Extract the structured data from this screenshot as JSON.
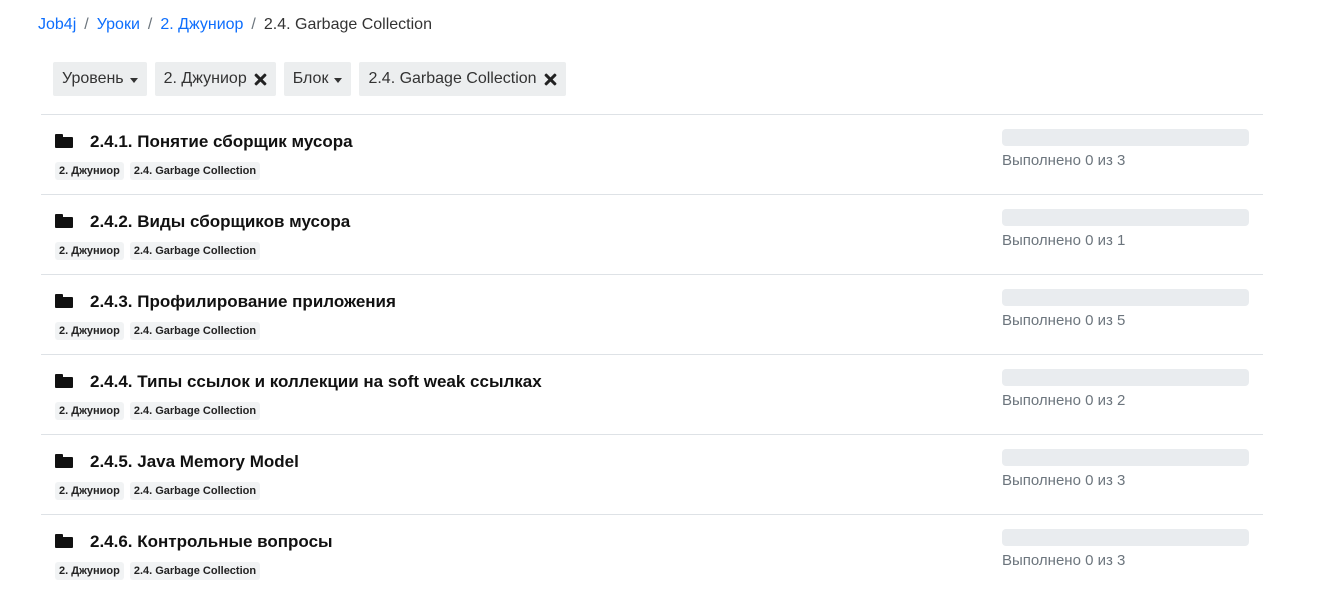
{
  "breadcrumb": {
    "items": [
      "Job4j",
      "Уроки",
      "2. Джуниор"
    ],
    "current": "2.4. Garbage Collection",
    "separator": "/"
  },
  "filters": {
    "level_label": "Уровень",
    "level_value": "2. Джуниор",
    "block_label": "Блок",
    "block_value": "2.4. Garbage Collection"
  },
  "lessons": [
    {
      "title": "2.4.1. Понятие сборщик мусора",
      "tags": [
        "2. Джуниор",
        "2.4. Garbage Collection"
      ],
      "status": "Выполнено 0 из 3",
      "progress": 0
    },
    {
      "title": "2.4.2. Виды сборщиков мусора",
      "tags": [
        "2. Джуниор",
        "2.4. Garbage Collection"
      ],
      "status": "Выполнено 0 из 1",
      "progress": 0
    },
    {
      "title": "2.4.3. Профилирование приложения",
      "tags": [
        "2. Джуниор",
        "2.4. Garbage Collection"
      ],
      "status": "Выполнено 0 из 5",
      "progress": 0
    },
    {
      "title": "2.4.4. Типы ссылок и коллекции на soft weak ссылках",
      "tags": [
        "2. Джуниор",
        "2.4. Garbage Collection"
      ],
      "status": "Выполнено 0 из 2",
      "progress": 0
    },
    {
      "title": "2.4.5. Java Memory Model",
      "tags": [
        "2. Джуниор",
        "2.4. Garbage Collection"
      ],
      "status": "Выполнено 0 из 3",
      "progress": 0
    },
    {
      "title": "2.4.6. Контрольные вопросы",
      "tags": [
        "2. Джуниор",
        "2.4. Garbage Collection"
      ],
      "status": "Выполнено 0 из 3",
      "progress": 0
    }
  ],
  "icons": {
    "lesson": "folder-icon",
    "remove": "close-icon",
    "dropdown": "caret-down-icon"
  }
}
